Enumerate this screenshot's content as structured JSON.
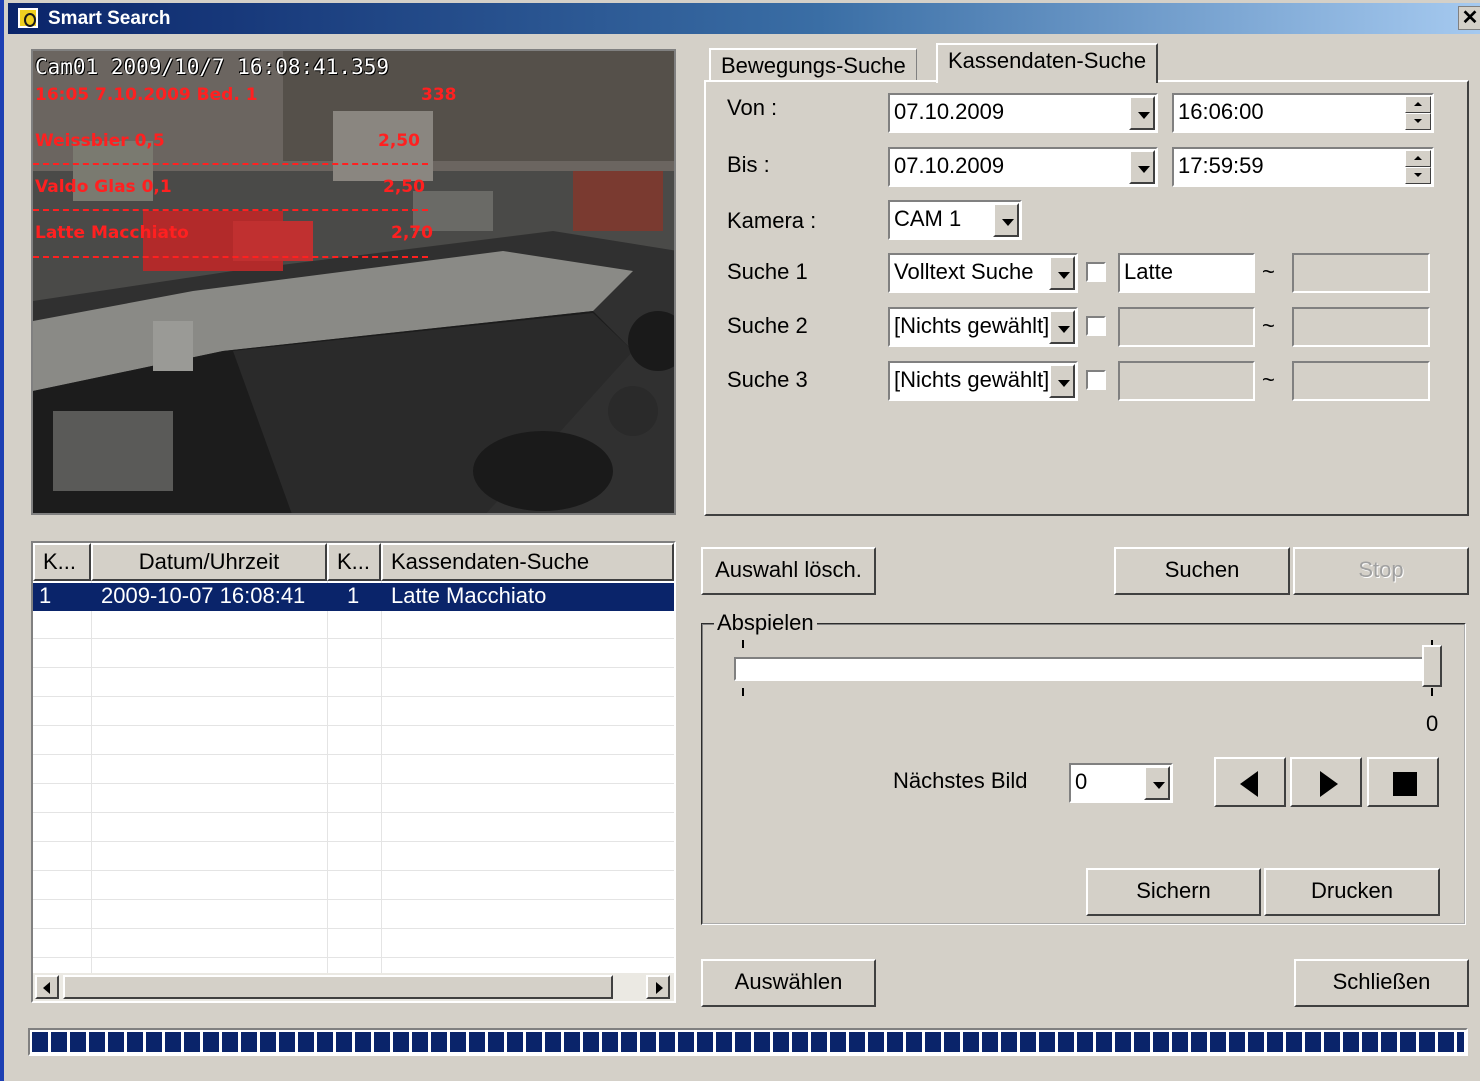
{
  "window": {
    "title": "Smart Search",
    "close_label": "✕"
  },
  "camera": {
    "timestamp": "Cam01  2009/10/7 16:08:41.359",
    "receipt_header": "16:05 7.10.2009 Bed. 1",
    "receipt_number": "338",
    "items": [
      {
        "name": "Weissbier 0,5",
        "price": "2,50"
      },
      {
        "name": "Valdo Glas 0,1",
        "price": "2,50"
      },
      {
        "name": "Latte Macchiato",
        "price": "2,70"
      }
    ]
  },
  "tabs": [
    {
      "label": "Bewegungs-Suche",
      "active": false
    },
    {
      "label": "Kassendaten-Suche",
      "active": true
    }
  ],
  "search": {
    "von_label": "Von :",
    "von_date": "07.10.2009",
    "von_time": "16:06:00",
    "bis_label": "Bis :",
    "bis_date": "07.10.2009",
    "bis_time": "17:59:59",
    "kamera_label": "Kamera :",
    "kamera_value": "CAM 1",
    "rows": [
      {
        "label": "Suche 1",
        "mode": "Volltext Suche",
        "value": "Latte",
        "range_end": "",
        "checked": false
      },
      {
        "label": "Suche 2",
        "mode": "[Nichts gewählt]",
        "value": "",
        "range_end": "",
        "checked": false
      },
      {
        "label": "Suche 3",
        "mode": "[Nichts gewählt]",
        "value": "",
        "range_end": "",
        "checked": false
      }
    ],
    "tilde": "~"
  },
  "results": {
    "columns": [
      "K...",
      "Datum/Uhrzeit",
      "K...",
      "Kassendaten-Suche"
    ],
    "rows": [
      {
        "k1": "1",
        "datetime": "2009-10-07 16:08:41",
        "k2": "1",
        "text": "Latte Macchiato",
        "selected": true
      }
    ]
  },
  "buttons": {
    "clear": "Auswahl lösch.",
    "search": "Suchen",
    "stop": "Stop",
    "save": "Sichern",
    "print": "Drucken",
    "select": "Auswählen",
    "close": "Schließen"
  },
  "playback": {
    "group_label": "Abspielen",
    "slider_value": "0",
    "slider_position": 1.0,
    "next_frame_label": "Nächstes Bild",
    "next_frame_value": "0"
  },
  "progress": {
    "fraction": 1.0
  },
  "colors": {
    "selection": "#0a246a",
    "overlay_text": "#ff2020",
    "titlebar": "#0a246a"
  },
  "icons": {
    "prev": "play-back-icon",
    "next": "play-forward-icon",
    "stop": "stop-icon"
  }
}
